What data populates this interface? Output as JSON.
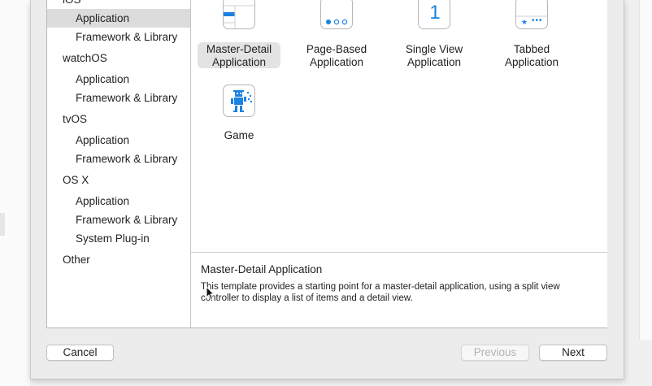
{
  "sidebar": {
    "items": [
      {
        "label": "iOS",
        "kind": "category"
      },
      {
        "label": "Application",
        "kind": "sub",
        "selected": true
      },
      {
        "label": "Framework & Library",
        "kind": "sub"
      },
      {
        "label": "watchOS",
        "kind": "category"
      },
      {
        "label": "Application",
        "kind": "sub"
      },
      {
        "label": "Framework & Library",
        "kind": "sub"
      },
      {
        "label": "tvOS",
        "kind": "category"
      },
      {
        "label": "Application",
        "kind": "sub"
      },
      {
        "label": "Framework & Library",
        "kind": "sub"
      },
      {
        "label": "OS X",
        "kind": "category"
      },
      {
        "label": "Application",
        "kind": "sub"
      },
      {
        "label": "Framework & Library",
        "kind": "sub"
      },
      {
        "label": "System Plug-in",
        "kind": "sub"
      },
      {
        "label": "Other",
        "kind": "category"
      }
    ]
  },
  "templates": [
    {
      "line1": "Master-Detail",
      "line2": "Application",
      "icon": "master-detail-icon",
      "selected": true
    },
    {
      "line1": "Page-Based",
      "line2": "Application",
      "icon": "page-dots-icon"
    },
    {
      "line1": "Single View",
      "line2": "Application",
      "icon": "single-view-icon",
      "glyph": "1"
    },
    {
      "line1": "Tabbed",
      "line2": "Application",
      "icon": "tab-bar-icon",
      "glyph_star": "★",
      "glyph_dots": "•••"
    },
    {
      "line1": "Game",
      "line2": "",
      "icon": "game-robot-icon"
    }
  ],
  "description": {
    "title": "Master-Detail Application",
    "body": "This template provides a starting point for a master-detail application, using a split view controller to display a list of items and a detail view."
  },
  "buttons": {
    "cancel": "Cancel",
    "previous": "Previous",
    "next": "Next"
  },
  "colors": {
    "accent": "#1a82e0",
    "selection": "#dcdcdc"
  }
}
